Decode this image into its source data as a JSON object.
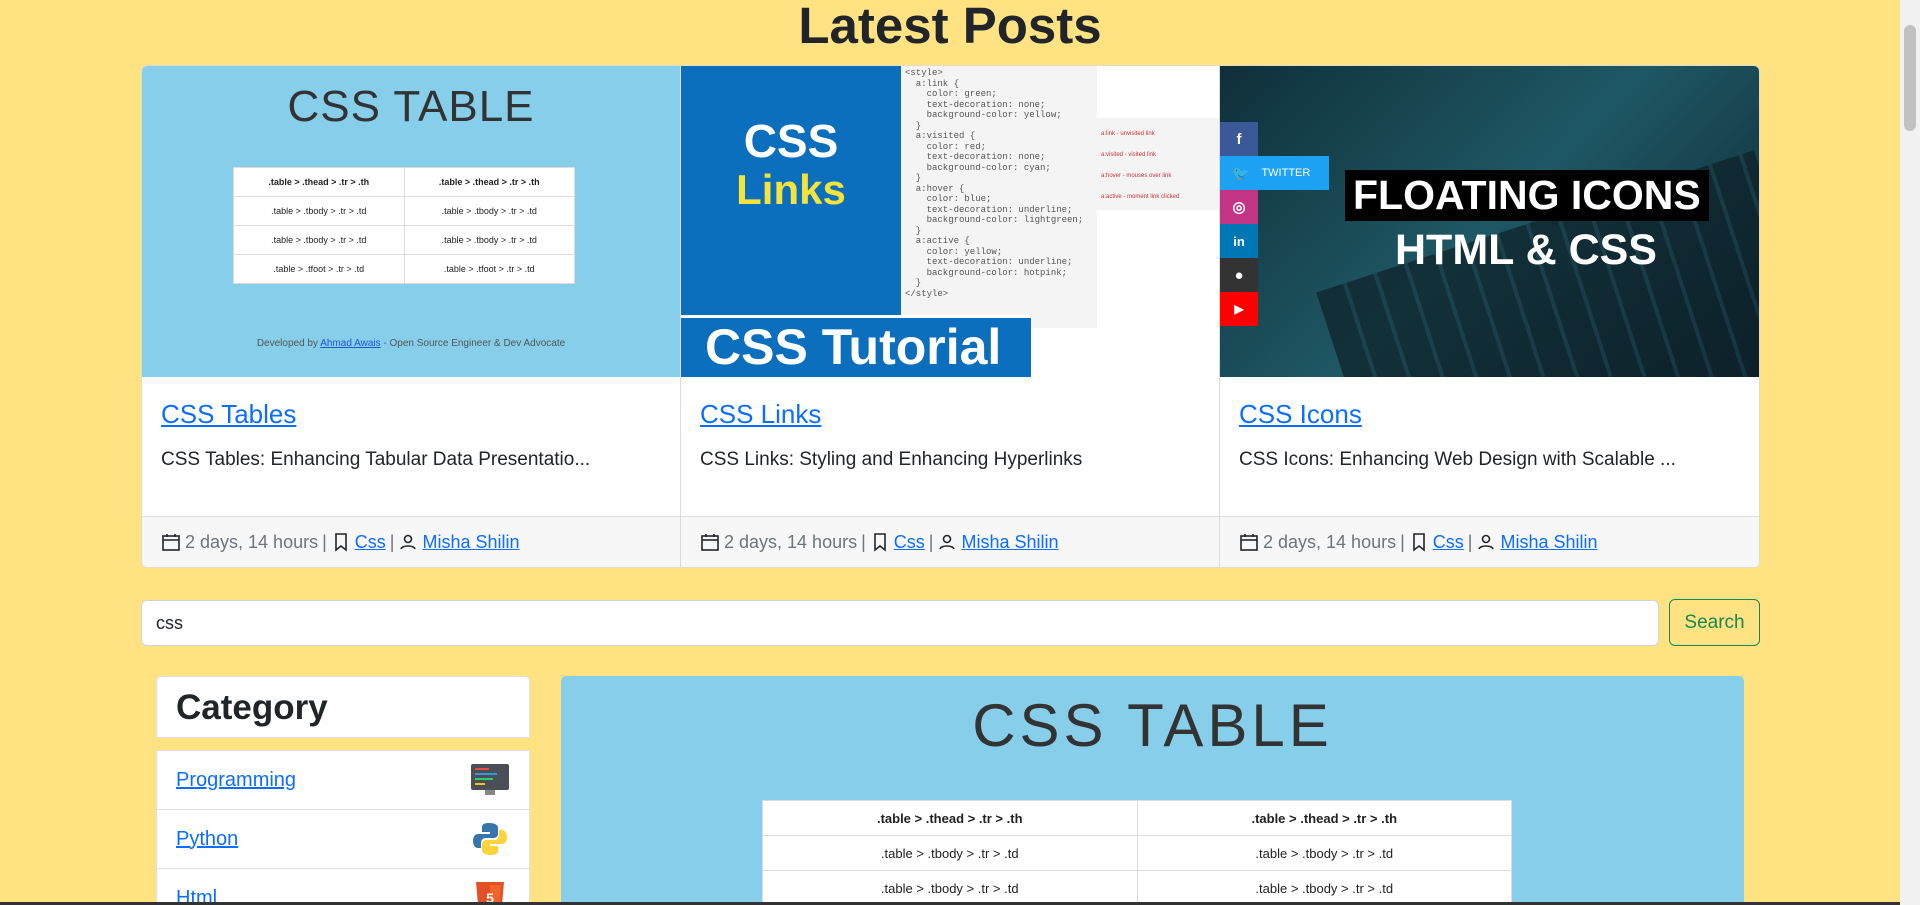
{
  "page_title": "Latest Posts",
  "posts": [
    {
      "title": "CSS Tables",
      "excerpt": "CSS Tables: Enhancing Tabular Data Presentatio...",
      "time": "2 days, 14 hours",
      "category": "Css",
      "author": "Misha Shilin",
      "image": {
        "heading": "CSS TABLE",
        "table": [
          [
            ".table > .thead > .tr > .th",
            ".table > .thead > .tr > .th"
          ],
          [
            ".table > .tbody > .tr > .td",
            ".table > .tbody > .tr > .td"
          ],
          [
            ".table > .tbody > .tr > .td",
            ".table > .tbody > .tr > .td"
          ],
          [
            ".table > .tfoot > .tr > .td",
            ".table > .tfoot > .tr > .td"
          ]
        ],
        "credit_prefix": "Developed by ",
        "credit_name": "Ahmad Awais",
        "credit_suffix": " - Open Source Engineer & Dev Advocate"
      }
    },
    {
      "title": "CSS Links",
      "excerpt": "CSS Links: Styling and Enhancing Hyperlinks",
      "time": "2 days, 14 hours",
      "category": "Css",
      "author": "Misha Shilin",
      "image": {
        "word1": "CSS",
        "word2": "Links",
        "banner": "CSS Tutorial",
        "code": "<style>\n  a:link {\n    color: green;\n    text-decoration: none;\n    background-color: yellow;\n  }\n  a:visited {\n    color: red;\n    text-decoration: none;\n    background-color: cyan;\n  }\n  a:hover {\n    color: blue;\n    text-decoration: underline;\n    background-color: lightgreen;\n  }\n  a:active {\n    color: yellow;\n    text-decoration: underline;\n    background-color: hotpink;\n  }\n</style>",
        "notes": [
          "a:link - unvisited link",
          "a:visited - visited link",
          "a:hover - mouses over link",
          "a:active - moment link clicked"
        ]
      }
    },
    {
      "title": "CSS Icons",
      "excerpt": "CSS Icons: Enhancing Web Design with Scalable ...",
      "time": "2 days, 14 hours",
      "category": "Css",
      "author": "Misha Shilin",
      "image": {
        "line1": "FLOATING ICONS",
        "line2": "HTML & CSS",
        "twitter_label": "TWITTER",
        "social": [
          {
            "icon": "facebook-icon",
            "color": "#3b5998",
            "glyph": "f"
          },
          {
            "icon": "instagram-icon",
            "color": "#c13584",
            "glyph": "◎"
          },
          {
            "icon": "linkedin-icon",
            "color": "#0077b5",
            "glyph": "in"
          },
          {
            "icon": "github-icon",
            "color": "#333333",
            "glyph": "●"
          },
          {
            "icon": "youtube-icon",
            "color": "#ff0000",
            "glyph": "▶"
          }
        ]
      }
    }
  ],
  "search": {
    "value": "css",
    "button_label": "Search"
  },
  "category": {
    "heading": "Category",
    "items": [
      {
        "label": "Programming",
        "icon": "monitor-code-icon"
      },
      {
        "label": "Python",
        "icon": "python-logo-icon"
      },
      {
        "label": "Html",
        "icon": "html5-logo-icon"
      }
    ]
  },
  "featured_image": {
    "heading": "CSS TABLE",
    "table": [
      [
        ".table > .thead > .tr > .th",
        ".table > .thead > .tr > .th"
      ],
      [
        ".table > .tbody > .tr > .td",
        ".table > .tbody > .tr > .td"
      ],
      [
        ".table > .tbody > .tr > .td",
        ".table > .tbody > .tr > .td"
      ]
    ]
  },
  "colors": {
    "page_bg": "#ffe383",
    "link": "#0d6efd",
    "search_button": "#198754",
    "image_sky": "#87ceeb"
  }
}
